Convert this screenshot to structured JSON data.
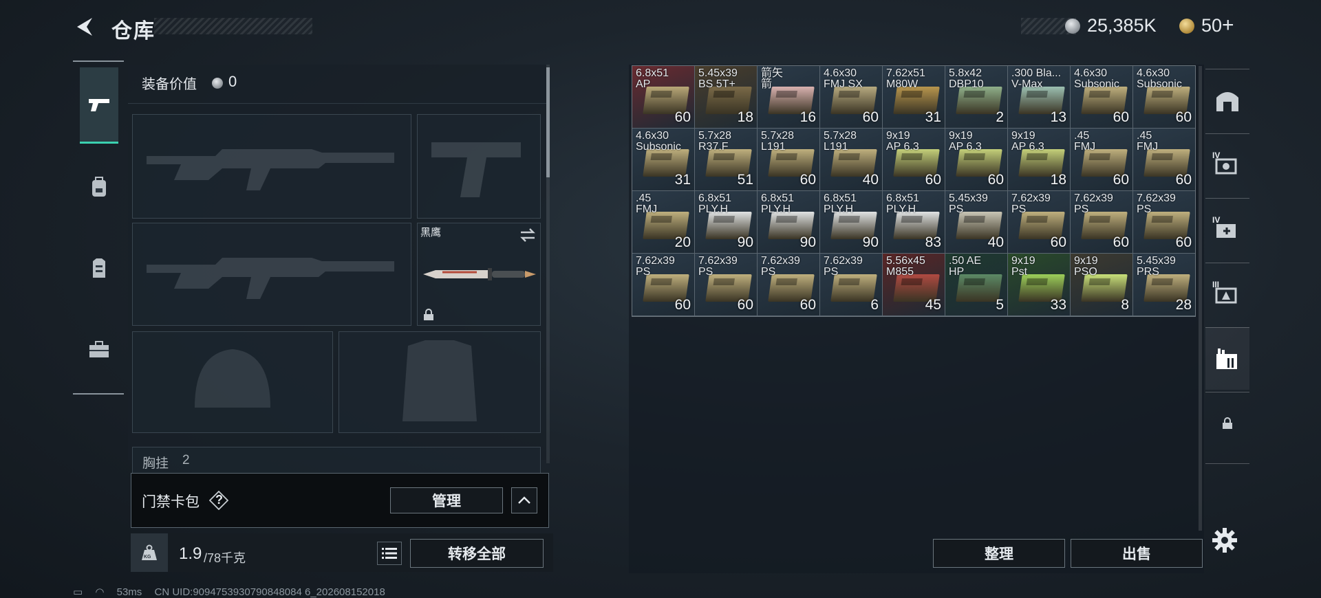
{
  "header": {
    "title": "仓库",
    "silver_value": "25,385K",
    "gold_value": "50",
    "plus_symbol": "+"
  },
  "loadout": {
    "equip_value_label": "装备价值",
    "equip_value": "0",
    "knife_name": "黑鹰",
    "cut_label": "胸挂",
    "cut_value": "2"
  },
  "keycard": {
    "label": "门禁卡包",
    "help_symbol": "?",
    "manage_label": "管理"
  },
  "weight": {
    "current": "1.9",
    "max": "/78千克",
    "kg_label": "KG",
    "transfer_label": "转移全部"
  },
  "storage": {
    "sort_label": "整理",
    "sell_label": "出售",
    "items": [
      {
        "name": "6.8x51\nAP",
        "qty": "60",
        "bg": "#6a2a30",
        "box": "#b9a878"
      },
      {
        "name": "5.45x39\nBS 5T+",
        "qty": "18",
        "bg": "#4a3e2c",
        "box": "#7a6a48"
      },
      {
        "name": "箭矢\n箭",
        "qty": "16",
        "bg": "#2b3a48",
        "box": "#d9b2b0"
      },
      {
        "name": "4.6x30\nFMJ SX",
        "qty": "60",
        "bg": "#2b3a48",
        "box": "#b7aa80"
      },
      {
        "name": "7.62x51\nM80W",
        "qty": "31",
        "bg": "#2b3a48",
        "box": "#b8964e"
      },
      {
        "name": "5.8x42\nDBP10",
        "qty": "2",
        "bg": "#2b3a48",
        "box": "#8fb08a"
      },
      {
        "name": ".300 Bla...\nV-Max",
        "qty": "13",
        "bg": "#2b3a48",
        "box": "#9cc0b2"
      },
      {
        "name": "4.6x30\nSubsonic",
        "qty": "60",
        "bg": "#2b3a48",
        "box": "#bfb07e"
      },
      {
        "name": "4.6x30\nSubsonic",
        "qty": "60",
        "bg": "#2b3a48",
        "box": "#bfb07e"
      },
      {
        "name": "4.6x30\nSubsonic",
        "qty": "31",
        "bg": "#2b3a48",
        "box": "#bfb07e"
      },
      {
        "name": "5.7x28\nR37.F",
        "qty": "51",
        "bg": "#2b3a48",
        "box": "#bfb07e"
      },
      {
        "name": "5.7x28\nL191",
        "qty": "60",
        "bg": "#2b3a48",
        "box": "#bfb07e"
      },
      {
        "name": "5.7x28\nL191",
        "qty": "40",
        "bg": "#2b3a48",
        "box": "#bfb07e"
      },
      {
        "name": "9x19\nAP 6.3",
        "qty": "60",
        "bg": "#2b3a48",
        "box": "#c4d07a"
      },
      {
        "name": "9x19\nAP 6.3",
        "qty": "60",
        "bg": "#2b3a48",
        "box": "#c4d07a"
      },
      {
        "name": "9x19\nAP 6.3",
        "qty": "18",
        "bg": "#2b3a48",
        "box": "#c4d07a"
      },
      {
        "name": ".45\nFMJ",
        "qty": "60",
        "bg": "#2b3a48",
        "box": "#bfb07e"
      },
      {
        "name": ".45\nFMJ",
        "qty": "60",
        "bg": "#2b3a48",
        "box": "#bfb07e"
      },
      {
        "name": ".45\nFMJ",
        "qty": "20",
        "bg": "#2b3a48",
        "box": "#bfb07e"
      },
      {
        "name": "6.8x51\nPLY.H",
        "qty": "90",
        "bg": "#2b3a48",
        "box": "#e0e3e4"
      },
      {
        "name": "6.8x51\nPLY.H",
        "qty": "90",
        "bg": "#2b3a48",
        "box": "#e0e3e4"
      },
      {
        "name": "6.8x51\nPLY.H",
        "qty": "90",
        "bg": "#2b3a48",
        "box": "#e0e3e4"
      },
      {
        "name": "6.8x51\nPLY.H",
        "qty": "83",
        "bg": "#2b3a48",
        "box": "#e0e3e4"
      },
      {
        "name": "5.45x39\nPS",
        "qty": "40",
        "bg": "#2b3a48",
        "box": "#c9c6b6"
      },
      {
        "name": "7.62x39\nPS",
        "qty": "60",
        "bg": "#2b3a48",
        "box": "#bfb07e"
      },
      {
        "name": "7.62x39\nPS",
        "qty": "60",
        "bg": "#2b3a48",
        "box": "#bfb07e"
      },
      {
        "name": "7.62x39\nPS",
        "qty": "60",
        "bg": "#2b3a48",
        "box": "#bfb07e"
      },
      {
        "name": "7.62x39\nPS",
        "qty": "60",
        "bg": "#2b3a48",
        "box": "#bfb07e"
      },
      {
        "name": "7.62x39\nPS",
        "qty": "60",
        "bg": "#2b3a48",
        "box": "#bfb07e"
      },
      {
        "name": "7.62x39\nPS",
        "qty": "60",
        "bg": "#2b3a48",
        "box": "#bfb07e"
      },
      {
        "name": "7.62x39\nPS",
        "qty": "6",
        "bg": "#2b3a48",
        "box": "#bfb07e"
      },
      {
        "name": "5.56x45\nM855",
        "qty": "45",
        "bg": "#5a2626",
        "box": "#b04a42"
      },
      {
        "name": ".50 AE\nHP",
        "qty": "5",
        "bg": "#1f3a30",
        "box": "#5c8a66"
      },
      {
        "name": "9x19\nPst",
        "qty": "33",
        "bg": "#2a4a2a",
        "box": "#9ccf5a"
      },
      {
        "name": "9x19\nPSO",
        "qty": "8",
        "bg": "#3d3a30",
        "box": "#c8e07a"
      },
      {
        "name": "5.45x39\nPRS",
        "qty": "28",
        "bg": "#2b3a48",
        "box": "#bfb07e"
      }
    ]
  },
  "right_tabs": [
    "IV",
    "IV",
    "III"
  ],
  "status": {
    "ping": "53ms",
    "uid": "CN UID:9094753930790848084 6_202608152018"
  }
}
